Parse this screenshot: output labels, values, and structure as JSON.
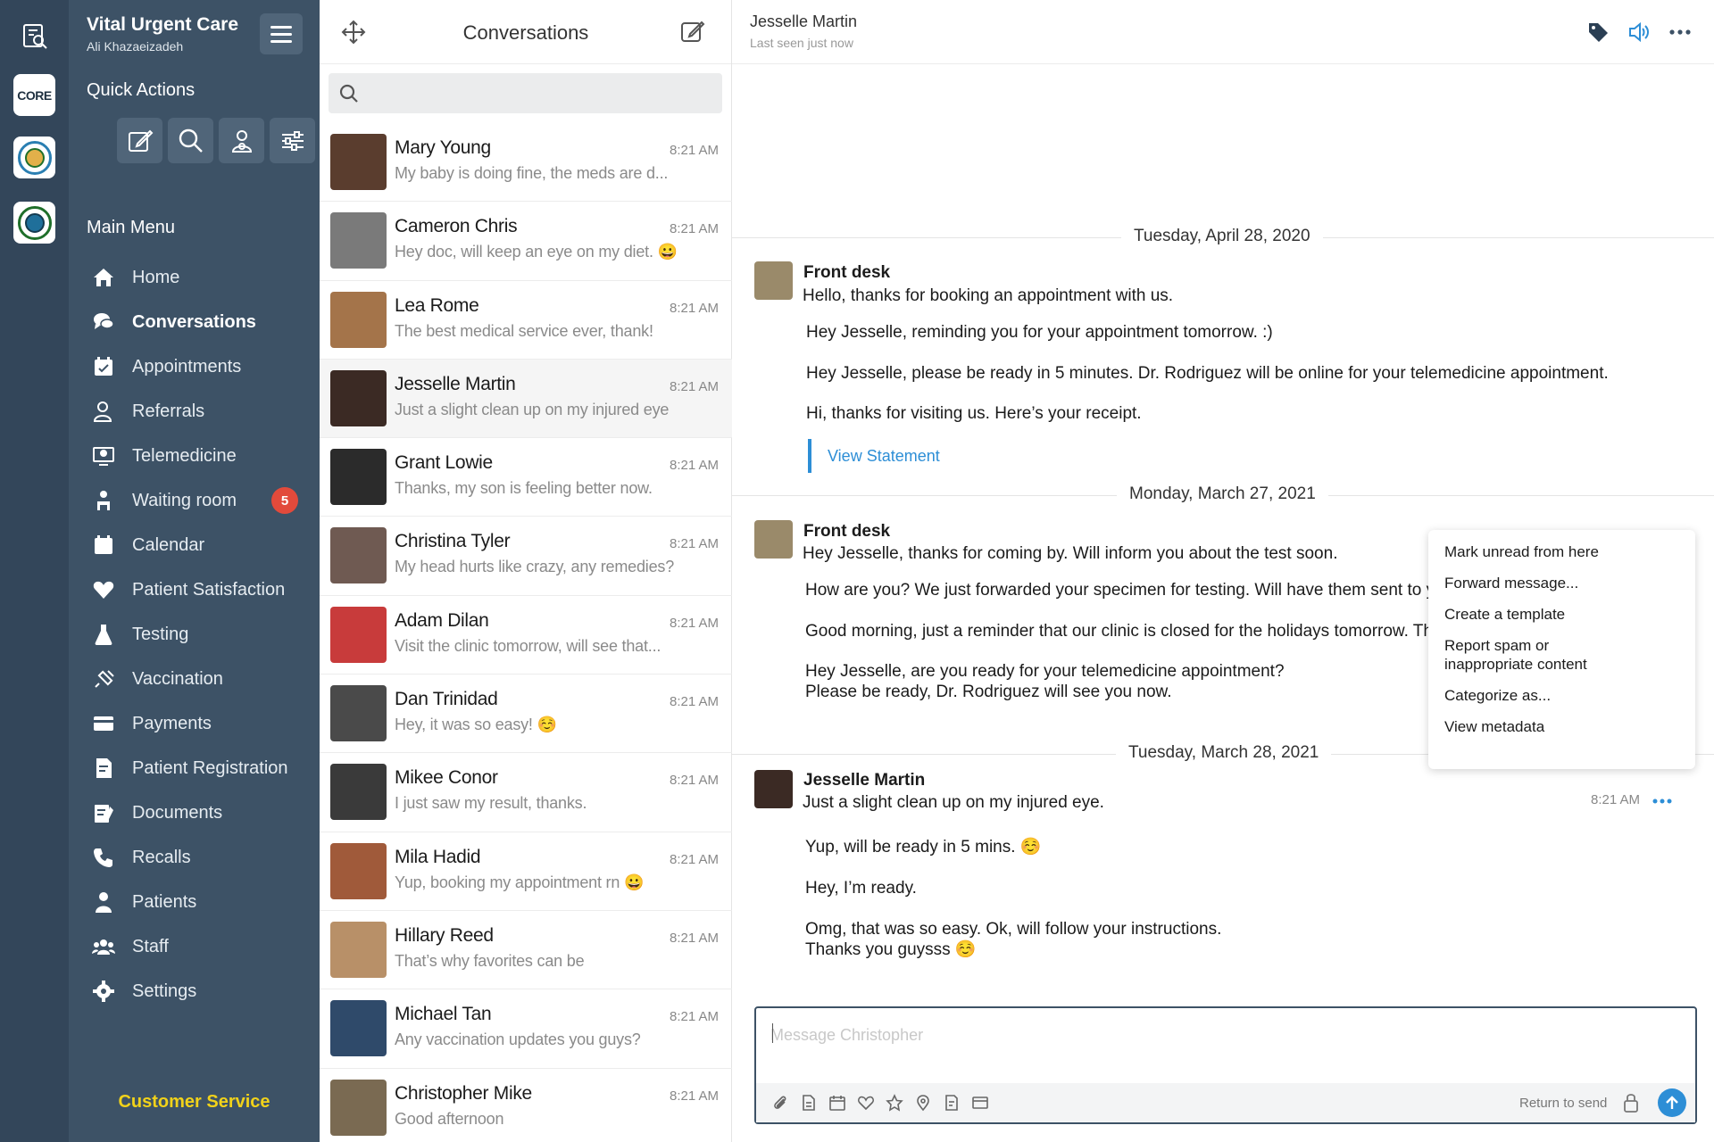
{
  "rail": {
    "logo_core": "CORE"
  },
  "sidebar": {
    "brand_title": "Vital Urgent Care",
    "brand_sub": "Ali Khazaeizadeh",
    "quick_actions_label": "Quick Actions",
    "main_menu_label": "Main Menu",
    "items": [
      {
        "label": "Home",
        "icon": "home-icon"
      },
      {
        "label": "Conversations",
        "icon": "chat-icon",
        "active": true
      },
      {
        "label": "Appointments",
        "icon": "calendar-check-icon"
      },
      {
        "label": "Referrals",
        "icon": "user-referral-icon"
      },
      {
        "label": "Telemedicine",
        "icon": "monitor-user-icon"
      },
      {
        "label": "Waiting room",
        "icon": "waiting-room-icon",
        "badge": "5"
      },
      {
        "label": "Calendar",
        "icon": "calendar-icon"
      },
      {
        "label": "Patient Satisfaction",
        "icon": "heart-icon"
      },
      {
        "label": "Testing",
        "icon": "flask-icon"
      },
      {
        "label": "Vaccination",
        "icon": "syringe-icon"
      },
      {
        "label": "Payments",
        "icon": "credit-card-icon"
      },
      {
        "label": "Patient Registration",
        "icon": "registration-icon"
      },
      {
        "label": "Documents",
        "icon": "documents-icon"
      },
      {
        "label": "Recalls",
        "icon": "phone-recall-icon"
      },
      {
        "label": "Patients",
        "icon": "patient-icon"
      },
      {
        "label": "Staff",
        "icon": "staff-icon"
      },
      {
        "label": "Settings",
        "icon": "gear-icon"
      }
    ],
    "customer_service": "Customer Service"
  },
  "convlist": {
    "title": "Conversations",
    "search_placeholder": "",
    "contacts": [
      {
        "name": "Mary Young",
        "time": "8:21 AM",
        "preview": "My baby is doing fine, the meds are d...",
        "avatar_color": "#5a3d2e"
      },
      {
        "name": "Cameron Chris",
        "time": "8:21 AM",
        "preview": "Hey doc, will keep an eye on my diet. 😀",
        "avatar_color": "#7a7a7a"
      },
      {
        "name": "Lea Rome",
        "time": "8:21 AM",
        "preview": "The best medical service ever, thank!",
        "avatar_color": "#a4744a"
      },
      {
        "name": "Jesselle Martin",
        "time": "8:21 AM",
        "preview": "Just a slight clean up on my injured eye",
        "avatar_color": "#3b2a24",
        "selected": true
      },
      {
        "name": "Grant Lowie",
        "time": "8:21 AM",
        "preview": "Thanks, my son is feeling better now.",
        "avatar_color": "#2b2b2b"
      },
      {
        "name": "Christina Tyler",
        "time": "8:21 AM",
        "preview": "My head hurts like crazy, any remedies?",
        "avatar_color": "#6f5a52"
      },
      {
        "name": "Adam Dilan",
        "time": "8:21 AM",
        "preview": "Visit the clinic tomorrow, will see that...",
        "avatar_color": "#c83b3b"
      },
      {
        "name": "Dan Trinidad",
        "time": "8:21 AM",
        "preview": "Hey, it was so easy! ☺️",
        "avatar_color": "#4a4a4a"
      },
      {
        "name": "Mikee Conor",
        "time": "8:21 AM",
        "preview": "I just saw my result, thanks.",
        "avatar_color": "#3a3a3a"
      },
      {
        "name": "Mila Hadid",
        "time": "8:21 AM",
        "preview": "Yup, booking my appointment rn 😀",
        "avatar_color": "#a05a3a"
      },
      {
        "name": "Hillary Reed",
        "time": "8:21 AM",
        "preview": "That’s why favorites can be",
        "avatar_color": "#b89068"
      },
      {
        "name": "Michael Tan",
        "time": "8:21 AM",
        "preview": "Any vaccination updates you guys?",
        "avatar_color": "#2f4a6a"
      },
      {
        "name": "Christopher Mike",
        "time": "8:21 AM",
        "preview": "Good afternoon",
        "avatar_color": "#7a6a52"
      }
    ]
  },
  "chat": {
    "header_name": "Jesselle Martin",
    "header_status": "Last seen just now",
    "days": [
      "Tuesday, April 28, 2020",
      "Monday, March 27, 2021",
      "Tuesday, March 28, 2021"
    ],
    "group1": {
      "sender": "Front desk",
      "messages": [
        "Hello, thanks for booking an appointment with us.",
        "Hey Jesselle, reminding you for your appointment tomorrow. :)",
        "Hey Jesselle, please be ready in 5 minutes. Dr. Rodriguez will be online for your telemedicine appointment.",
        "Hi, thanks for visiting us. Here’s your receipt."
      ],
      "link": "View Statement"
    },
    "group2": {
      "sender": "Front desk",
      "messages": [
        "Hey Jesselle, thanks for coming by. Will inform you about the test soon.",
        "How are you? We just forwarded your specimen for testing. Will have them sent to y",
        "Good morning, just a reminder that our clinic is closed for the holidays tomorrow. Th",
        "Hey Jesselle, are you ready for your telemedicine appointment?",
        "Please be ready, Dr. Rodriguez will see you now."
      ]
    },
    "group3": {
      "sender": "Jesselle Martin",
      "time": "8:21 AM",
      "messages": [
        "Just a slight clean up on my injured eye.",
        "Yup, will be ready in 5 mins. ☺️",
        "Hey, I’m ready.",
        "Omg, that was so easy. Ok, will follow your instructions.",
        "Thanks you guysss ☺️"
      ]
    },
    "context_menu": [
      "Mark unread from here",
      "Forward message...",
      "Create a template",
      "Report spam or inappropriate content",
      "Categorize as...",
      "View metadata"
    ],
    "composer": {
      "placeholder": "Message Christopher",
      "return_to_send": "Return to send"
    }
  },
  "colors": {
    "rail": "#33465a",
    "sidebar": "#3d5266",
    "accent": "#2d8ed6",
    "badge": "#e24a3b",
    "customer_service": "#f1d21a"
  }
}
